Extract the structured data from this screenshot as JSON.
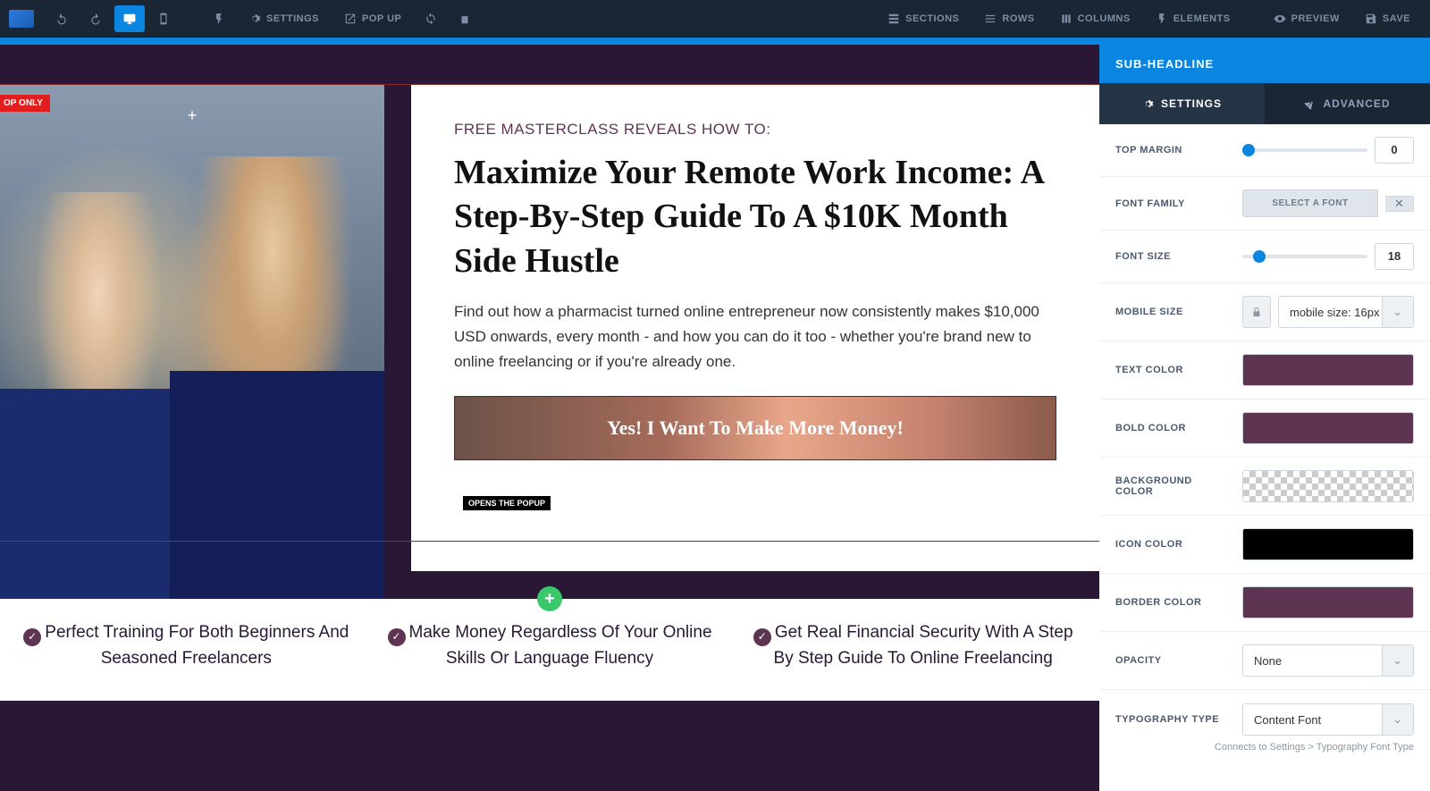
{
  "toolbar": {
    "settings": "SETTINGS",
    "popup": "POP UP",
    "sections": "SECTIONS",
    "rows": "ROWS",
    "columns": "COLUMNS",
    "elements": "ELEMENTS",
    "preview": "PREVIEW",
    "save": "SAVE"
  },
  "canvas": {
    "badge": "OP ONLY",
    "eyebrow": "FREE MASTERCLASS REVEALS HOW TO:",
    "headline": "Maximize Your Remote Work Income: A Step-By-Step Guide To A $10K Month Side Hustle",
    "body": "Find out how a pharmacist turned online entrepreneur now consistently makes $10,000 USD onwards, every month - and how you can do it too - whether you're brand new to online freelancing or if you're already one.",
    "cta": "Yes! I Want To Make More Money!",
    "popup_tag": "OPENS THE POPUP",
    "benefits": [
      "Perfect Training For Both Beginners And Seasoned Freelancers",
      "Make Money Regardless Of Your Online Skills Or Language Fluency",
      "Get Real Financial Security With A Step By Step Guide To Online Freelancing"
    ]
  },
  "sidebar": {
    "title": "SUB-HEADLINE",
    "tabs": {
      "settings": "SETTINGS",
      "advanced": "ADVANCED"
    },
    "top_margin": {
      "label": "TOP MARGIN",
      "value": "0"
    },
    "font_family": {
      "label": "FONT FAMILY",
      "button": "SELECT A FONT"
    },
    "font_size": {
      "label": "FONT SIZE",
      "value": "18"
    },
    "mobile_size": {
      "label": "MOBILE SIZE",
      "value": "mobile size: 16px"
    },
    "text_color": {
      "label": "TEXT COLOR",
      "value": "#5d3552"
    },
    "bold_color": {
      "label": "BOLD COLOR",
      "value": "#5d3552"
    },
    "bg_color": {
      "label": "BACKGROUND COLOR",
      "value": "transparent"
    },
    "icon_color": {
      "label": "ICON COLOR",
      "value": "#000000"
    },
    "border_color": {
      "label": "BORDER COLOR",
      "value": "#5d3552"
    },
    "opacity": {
      "label": "OPACITY",
      "value": "None"
    },
    "typography": {
      "label": "TYPOGRAPHY TYPE",
      "value": "Content Font",
      "hint": "Connects to Settings > Typography Font Type"
    }
  }
}
